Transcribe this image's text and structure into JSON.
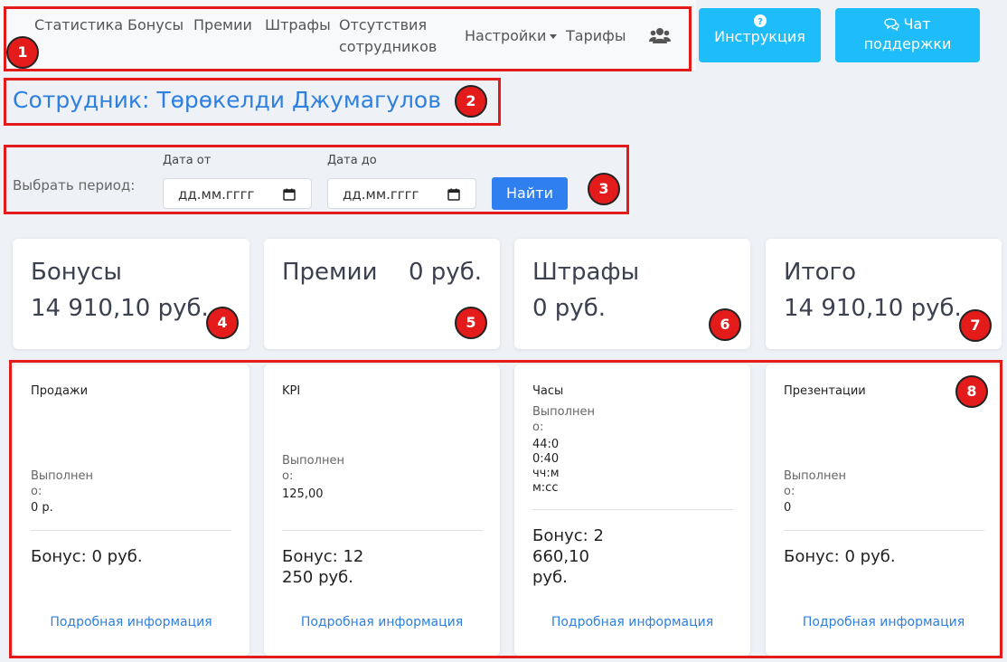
{
  "nav": {
    "items": [
      "Статистика",
      "Бонусы",
      "Премии",
      "Штрафы",
      "Отсутствия сотрудников",
      "Настройки",
      "Тарифы"
    ],
    "instruction_label": "Инструкция",
    "chat_line1": "Чат",
    "chat_line2": "поддержки",
    "team_icon": "users-icon"
  },
  "page": {
    "title": "Сотрудник: Төрөкелди Джумагулов"
  },
  "period": {
    "label": "Выбрать период:",
    "from_label": "Дата от",
    "to_label": "Дата до",
    "from_value": "дд.мм.гггг",
    "to_value": "дд.мм.гггг",
    "find_label": "Найти"
  },
  "summary": [
    {
      "title": "Бонусы",
      "value": "14 910,10 руб."
    },
    {
      "title": "Премии",
      "value": "0 руб."
    },
    {
      "title": "Штрафы",
      "value": "0 руб."
    },
    {
      "title": "Итого",
      "value": "14 910,10 руб."
    }
  ],
  "metrics": [
    {
      "title": "Продажи",
      "done_label": "Выполнено:",
      "done_value": "0 р.",
      "bonus": "Бонус: 0 руб.",
      "details": "Подробная информация"
    },
    {
      "title": "KPI",
      "done_label": "Выполнено:",
      "done_value": "125,00",
      "bonus": "Бонус: 12 250 руб.",
      "details": "Подробная информация"
    },
    {
      "title": "Часы",
      "done_label": "Выполнено:",
      "done_value": "44:00:40 чч:мм:сс",
      "bonus": "Бонус: 2 660,10 руб.",
      "details": "Подробная информация"
    },
    {
      "title": "Презентации",
      "done_label": "Выполнено:",
      "done_value": "0",
      "bonus": "Бонус: 0 руб.",
      "details": "Подробная информация"
    }
  ],
  "annotations": [
    "1",
    "2",
    "3",
    "4",
    "5",
    "6",
    "7",
    "8"
  ],
  "colors": {
    "accent": "#2d7fe0",
    "help_button": "#1ebcf8",
    "highlight": "#e31b1b",
    "background": "#eef2f7"
  }
}
